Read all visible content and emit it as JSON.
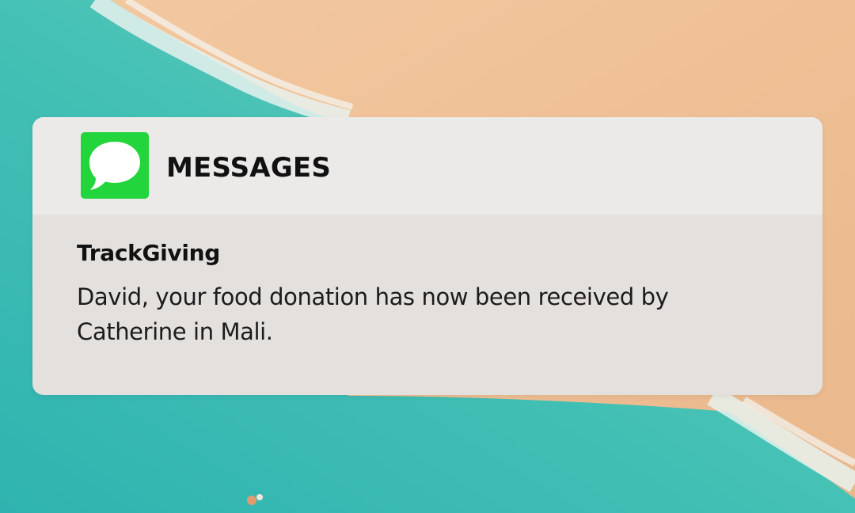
{
  "wallpaper": {
    "icon": "beach-aerial-wallpaper",
    "colors": {
      "sand": "#f0c39a",
      "sea": "#3cbab2",
      "foam": "#e8f2ee"
    }
  },
  "notification": {
    "app": {
      "name": "MESSAGES",
      "icon": "messages-app-icon",
      "icon_color": "#23d53c"
    },
    "sender": "TrackGiving",
    "message": "David, your food donation has now been received by Catherine in Mali."
  }
}
